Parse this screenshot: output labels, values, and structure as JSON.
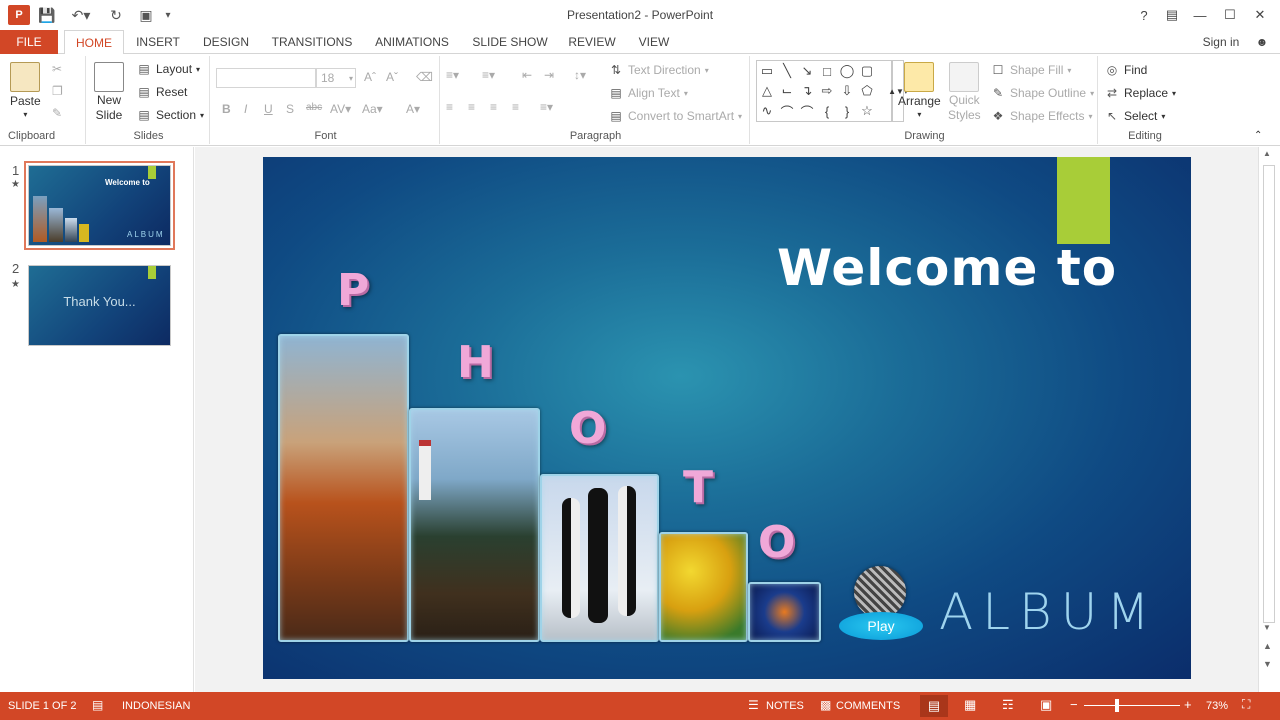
{
  "app": {
    "title": "Presentation2 - PowerPoint",
    "signin": "Sign in"
  },
  "tabs": [
    "FILE",
    "HOME",
    "INSERT",
    "DESIGN",
    "TRANSITIONS",
    "ANIMATIONS",
    "SLIDE SHOW",
    "REVIEW",
    "VIEW"
  ],
  "ribbon": {
    "clipboard": {
      "label": "Clipboard",
      "paste": "Paste"
    },
    "slides": {
      "label": "Slides",
      "new_slide_1": "New",
      "new_slide_2": "Slide",
      "layout": "Layout",
      "reset": "Reset",
      "section": "Section"
    },
    "font": {
      "label": "Font",
      "size": "18"
    },
    "paragraph": {
      "label": "Paragraph",
      "text_direction": "Text Direction",
      "align_text": "Align Text",
      "convert_smartart": "Convert to SmartArt"
    },
    "drawing": {
      "label": "Drawing",
      "arrange": "Arrange",
      "quick_1": "Quick",
      "quick_2": "Styles",
      "shape_fill": "Shape Fill",
      "shape_outline": "Shape Outline",
      "shape_effects": "Shape Effects"
    },
    "editing": {
      "label": "Editing",
      "find": "Find",
      "replace": "Replace",
      "select": "Select"
    }
  },
  "thumbnails": [
    {
      "num": "1",
      "text": "Welcome to"
    },
    {
      "num": "2",
      "text": "Thank You..."
    }
  ],
  "slide": {
    "title": "Welcome to",
    "letters": [
      "P",
      "H",
      "O",
      "T",
      "O"
    ],
    "play": "Play",
    "album": "ALBUM"
  },
  "status": {
    "slide": "SLIDE 1 OF 2",
    "language": "INDONESIAN",
    "notes": "NOTES",
    "comments": "COMMENTS",
    "zoom": "73%"
  },
  "colors": {
    "accent": "#d24726",
    "slide_bg": "#1b6d98",
    "title_block": "#a8cd38"
  }
}
